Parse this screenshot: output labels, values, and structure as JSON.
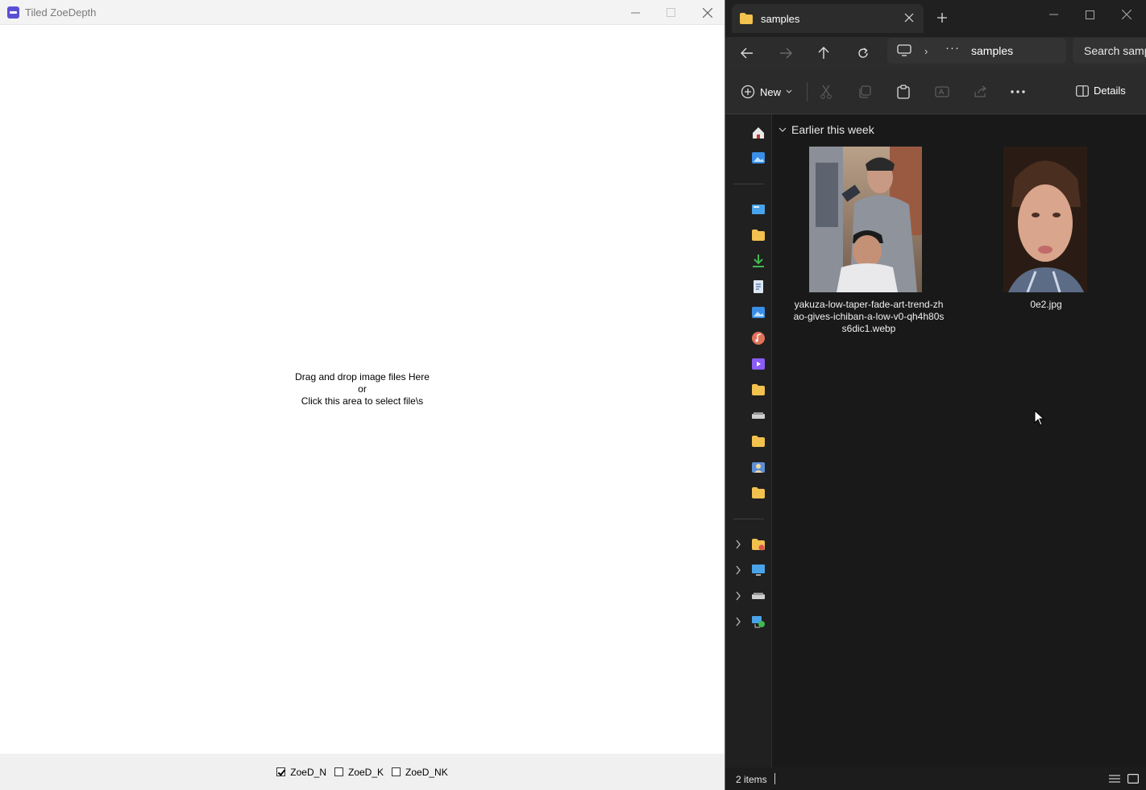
{
  "zoe_window": {
    "title": "Tiled ZoeDepth",
    "drop_line1": "Drag and drop image files Here",
    "drop_line2": "or",
    "drop_line3": "Click this area to select file\\s",
    "checkboxes": [
      {
        "label": "ZoeD_N",
        "checked": true
      },
      {
        "label": "ZoeD_K",
        "checked": false
      },
      {
        "label": "ZoeD_NK",
        "checked": false
      }
    ]
  },
  "explorer": {
    "tab_title": "samples",
    "address_path": "samples",
    "search_placeholder": "Search samples",
    "toolbar": {
      "new_label": "New",
      "details_label": "Details"
    },
    "group_header": "Earlier this week",
    "files": [
      {
        "name_line1": "yakuza-low-taper-fade-art-trend-zh",
        "name_line2": "ao-gives-ichiban-a-low-v0-qh4h80s",
        "name_line3": "s6dic1.webp"
      },
      {
        "name_line1": "0e2.jpg"
      }
    ],
    "status_count": "2 items"
  },
  "colors": {
    "explorer_bg": "#191919",
    "folder_yellow": "#f2c14e",
    "app_icon": "#5a4fd4"
  }
}
